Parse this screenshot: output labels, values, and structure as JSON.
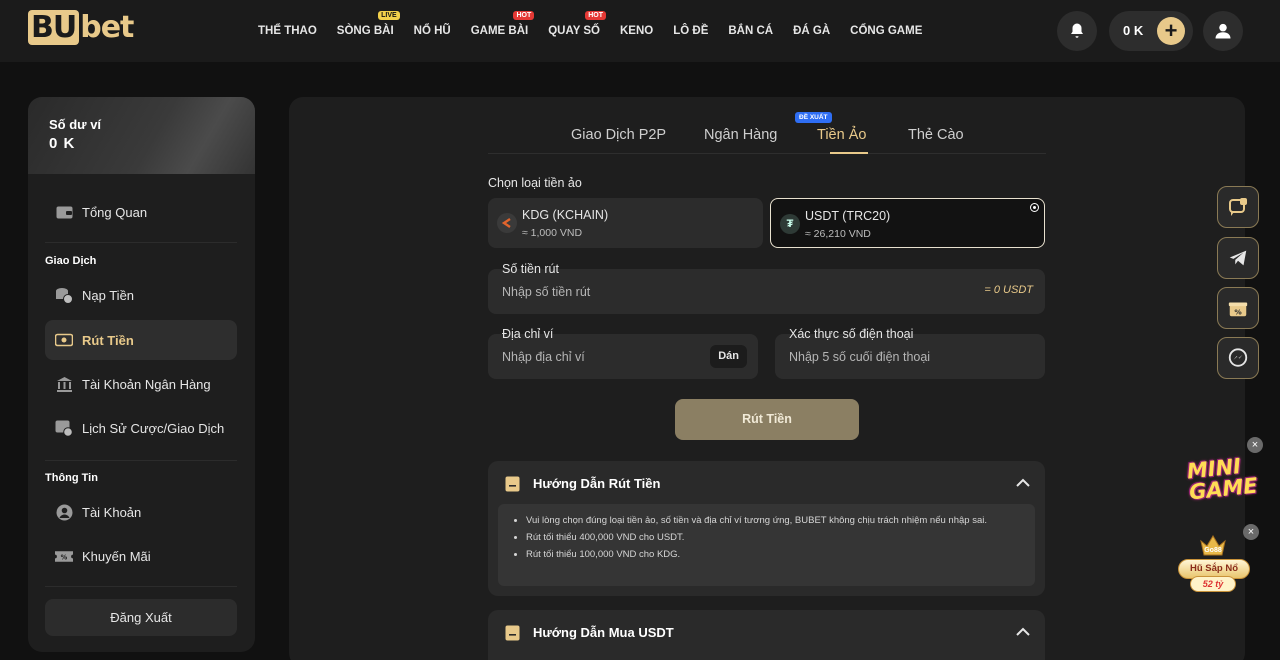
{
  "brand": {
    "logo_text_bu": "BU",
    "logo_text_bet": "bet"
  },
  "nav": [
    {
      "label": "THỂ THAO",
      "badge": ""
    },
    {
      "label": "SÒNG BÀI",
      "badge": "LIVE"
    },
    {
      "label": "NỔ HŨ",
      "badge": ""
    },
    {
      "label": "GAME BÀI",
      "badge": "HOT"
    },
    {
      "label": "QUAY SỐ",
      "badge": "HOT"
    },
    {
      "label": "KENO",
      "badge": ""
    },
    {
      "label": "LÔ ĐỀ",
      "badge": ""
    },
    {
      "label": "BẮN CÁ",
      "badge": ""
    },
    {
      "label": "ĐÁ GÀ",
      "badge": ""
    },
    {
      "label": "CỔNG GAME",
      "badge": ""
    }
  ],
  "header": {
    "balance": "0 K",
    "plus": "+"
  },
  "sidebar": {
    "wallet_label": "Số dư ví",
    "wallet_value": "0 K",
    "overview": "Tổng Quan",
    "section_transactions": "Giao Dịch",
    "deposit": "Nạp Tiền",
    "withdraw": "Rút Tiền",
    "bank_account": "Tài Khoản Ngân Hàng",
    "history": "Lịch Sử Cược/Giao Dịch",
    "section_info": "Thông Tin",
    "account": "Tài Khoản",
    "promotions": "Khuyến Mãi",
    "logout": "Đăng Xuất"
  },
  "tabs": {
    "p2p": "Giao Dịch P2P",
    "p2p_badge": "ĐỀ XUẤT",
    "bank": "Ngân Hàng",
    "crypto": "Tiền Ảo",
    "card": "Thẻ Cào"
  },
  "form": {
    "choose_crypto_label": "Chọn loại tiền ảo",
    "coins": [
      {
        "name": "KDG (KCHAIN)",
        "rate": "≈ 1,000 VND",
        "selected": false,
        "color": "#e0642d"
      },
      {
        "name": "USDT (TRC20)",
        "rate": "≈ 26,210 VND",
        "selected": true,
        "color": "#2a9d7c"
      }
    ],
    "amount_label": "Số tiền rút",
    "amount_placeholder": "Nhập số tiền rút",
    "amount_suffix": "= 0 USDT",
    "address_label": "Địa chỉ ví",
    "address_placeholder": "Nhập địa chỉ ví",
    "paste_label": "Dán",
    "phone_label": "Xác thực số điện thoại",
    "phone_placeholder": "Nhập 5 số cuối điện thoại",
    "submit_label": "Rút Tiền"
  },
  "guides": [
    {
      "title": "Hướng Dẫn Rút Tiền",
      "items": [
        "Vui lòng chọn đúng loại tiền ảo, số tiền và địa chỉ ví tương ứng, BUBET không chịu trách nhiệm nếu nhập sai.",
        "Rút tối thiểu 400,000 VND cho USDT.",
        "Rút tối thiểu 100,000 VND cho KDG."
      ]
    },
    {
      "title": "Hướng Dẫn Mua USDT",
      "items": []
    }
  ],
  "floating": {
    "mini_game_line1": "MINI",
    "mini_game_line2": "GAME",
    "jackpot_name": "Go88",
    "jackpot_label": "Hũ Sắp Nổ",
    "jackpot_amount": "52 tỷ",
    "close": "×"
  },
  "colors": {
    "accent": "#e8c98a",
    "submit": "#8b7f63",
    "tab_badge": "#2f6ef3"
  }
}
